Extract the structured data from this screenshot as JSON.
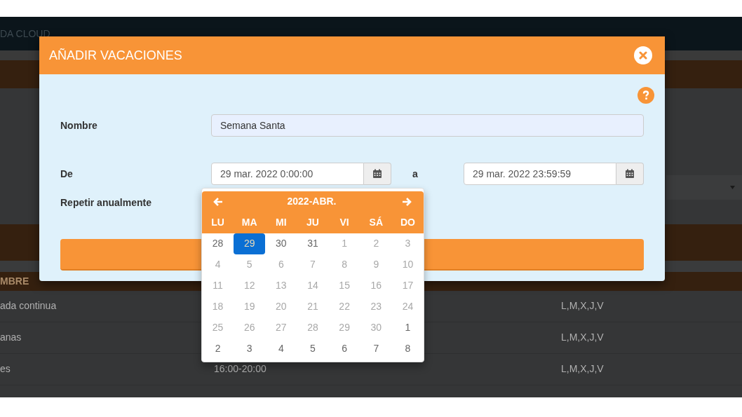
{
  "app_header": {
    "brand": "DA CLOUD"
  },
  "table": {
    "columns": [
      "MBRE"
    ],
    "rows": [
      {
        "column_1": "ada continua",
        "column_3": "L,M,X,J,V"
      },
      {
        "column_1": "anas",
        "column_3": "L,M,X,J,V"
      },
      {
        "column_1": "es",
        "column_2": "16:00-20:00",
        "column_3": "L,M,X,J,V"
      }
    ]
  },
  "dialog": {
    "title": "AÑADIR VACACIONES",
    "name_field": {
      "label": "Nombre",
      "value": "Semana Santa"
    },
    "from_field": {
      "label": "De",
      "value": "29 mar. 2022 0:00:00"
    },
    "range_separator": "a",
    "to_field": {
      "value": "29 mar. 2022 23:59:59"
    },
    "repeat_field": {
      "label": "Repetir anualmente"
    }
  },
  "calendar": {
    "title": "2022-ABR.",
    "weekdays": [
      "LU",
      "MA",
      "MI",
      "JU",
      "VI",
      "SÁ",
      "DO"
    ],
    "weeks": [
      [
        {
          "day": "28",
          "selected": false,
          "disabled": false
        },
        {
          "day": "29",
          "selected": true,
          "disabled": false
        },
        {
          "day": "30",
          "selected": false,
          "disabled": false
        },
        {
          "day": "31",
          "selected": false,
          "disabled": false
        },
        {
          "day": "1",
          "selected": false,
          "disabled": true
        },
        {
          "day": "2",
          "selected": false,
          "disabled": true
        },
        {
          "day": "3",
          "selected": false,
          "disabled": true
        }
      ],
      [
        {
          "day": "4",
          "selected": false,
          "disabled": true
        },
        {
          "day": "5",
          "selected": false,
          "disabled": true
        },
        {
          "day": "6",
          "selected": false,
          "disabled": true
        },
        {
          "day": "7",
          "selected": false,
          "disabled": true
        },
        {
          "day": "8",
          "selected": false,
          "disabled": true
        },
        {
          "day": "9",
          "selected": false,
          "disabled": true
        },
        {
          "day": "10",
          "selected": false,
          "disabled": true
        }
      ],
      [
        {
          "day": "11",
          "selected": false,
          "disabled": true
        },
        {
          "day": "12",
          "selected": false,
          "disabled": true
        },
        {
          "day": "13",
          "selected": false,
          "disabled": true
        },
        {
          "day": "14",
          "selected": false,
          "disabled": true
        },
        {
          "day": "15",
          "selected": false,
          "disabled": true
        },
        {
          "day": "16",
          "selected": false,
          "disabled": true
        },
        {
          "day": "17",
          "selected": false,
          "disabled": true
        }
      ],
      [
        {
          "day": "18",
          "selected": false,
          "disabled": true
        },
        {
          "day": "19",
          "selected": false,
          "disabled": true
        },
        {
          "day": "20",
          "selected": false,
          "disabled": true
        },
        {
          "day": "21",
          "selected": false,
          "disabled": true
        },
        {
          "day": "22",
          "selected": false,
          "disabled": true
        },
        {
          "day": "23",
          "selected": false,
          "disabled": true
        },
        {
          "day": "24",
          "selected": false,
          "disabled": true
        }
      ],
      [
        {
          "day": "25",
          "selected": false,
          "disabled": true
        },
        {
          "day": "26",
          "selected": false,
          "disabled": true
        },
        {
          "day": "27",
          "selected": false,
          "disabled": true
        },
        {
          "day": "28",
          "selected": false,
          "disabled": true
        },
        {
          "day": "29",
          "selected": false,
          "disabled": true
        },
        {
          "day": "30",
          "selected": false,
          "disabled": true
        },
        {
          "day": "1",
          "selected": false,
          "disabled": false
        }
      ],
      [
        {
          "day": "2",
          "selected": false,
          "disabled": false
        },
        {
          "day": "3",
          "selected": false,
          "disabled": false
        },
        {
          "day": "4",
          "selected": false,
          "disabled": false
        },
        {
          "day": "5",
          "selected": false,
          "disabled": false
        },
        {
          "day": "6",
          "selected": false,
          "disabled": false
        },
        {
          "day": "7",
          "selected": false,
          "disabled": false
        },
        {
          "day": "8",
          "selected": false,
          "disabled": false
        }
      ]
    ]
  }
}
